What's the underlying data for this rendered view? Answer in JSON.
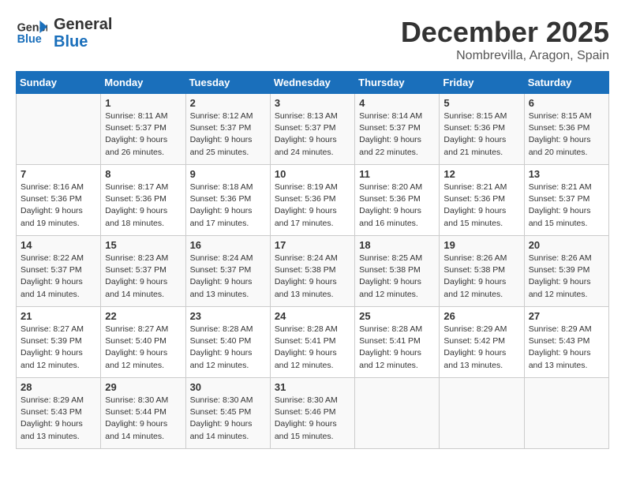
{
  "header": {
    "logo_line1": "General",
    "logo_line2": "Blue",
    "month": "December 2025",
    "location": "Nombrevilla, Aragon, Spain"
  },
  "weekdays": [
    "Sunday",
    "Monday",
    "Tuesday",
    "Wednesday",
    "Thursday",
    "Friday",
    "Saturday"
  ],
  "weeks": [
    [
      {
        "day": "",
        "info": ""
      },
      {
        "day": "1",
        "info": "Sunrise: 8:11 AM\nSunset: 5:37 PM\nDaylight: 9 hours\nand 26 minutes."
      },
      {
        "day": "2",
        "info": "Sunrise: 8:12 AM\nSunset: 5:37 PM\nDaylight: 9 hours\nand 25 minutes."
      },
      {
        "day": "3",
        "info": "Sunrise: 8:13 AM\nSunset: 5:37 PM\nDaylight: 9 hours\nand 24 minutes."
      },
      {
        "day": "4",
        "info": "Sunrise: 8:14 AM\nSunset: 5:37 PM\nDaylight: 9 hours\nand 22 minutes."
      },
      {
        "day": "5",
        "info": "Sunrise: 8:15 AM\nSunset: 5:36 PM\nDaylight: 9 hours\nand 21 minutes."
      },
      {
        "day": "6",
        "info": "Sunrise: 8:15 AM\nSunset: 5:36 PM\nDaylight: 9 hours\nand 20 minutes."
      }
    ],
    [
      {
        "day": "7",
        "info": "Sunrise: 8:16 AM\nSunset: 5:36 PM\nDaylight: 9 hours\nand 19 minutes."
      },
      {
        "day": "8",
        "info": "Sunrise: 8:17 AM\nSunset: 5:36 PM\nDaylight: 9 hours\nand 18 minutes."
      },
      {
        "day": "9",
        "info": "Sunrise: 8:18 AM\nSunset: 5:36 PM\nDaylight: 9 hours\nand 17 minutes."
      },
      {
        "day": "10",
        "info": "Sunrise: 8:19 AM\nSunset: 5:36 PM\nDaylight: 9 hours\nand 17 minutes."
      },
      {
        "day": "11",
        "info": "Sunrise: 8:20 AM\nSunset: 5:36 PM\nDaylight: 9 hours\nand 16 minutes."
      },
      {
        "day": "12",
        "info": "Sunrise: 8:21 AM\nSunset: 5:36 PM\nDaylight: 9 hours\nand 15 minutes."
      },
      {
        "day": "13",
        "info": "Sunrise: 8:21 AM\nSunset: 5:37 PM\nDaylight: 9 hours\nand 15 minutes."
      }
    ],
    [
      {
        "day": "14",
        "info": "Sunrise: 8:22 AM\nSunset: 5:37 PM\nDaylight: 9 hours\nand 14 minutes."
      },
      {
        "day": "15",
        "info": "Sunrise: 8:23 AM\nSunset: 5:37 PM\nDaylight: 9 hours\nand 14 minutes."
      },
      {
        "day": "16",
        "info": "Sunrise: 8:24 AM\nSunset: 5:37 PM\nDaylight: 9 hours\nand 13 minutes."
      },
      {
        "day": "17",
        "info": "Sunrise: 8:24 AM\nSunset: 5:38 PM\nDaylight: 9 hours\nand 13 minutes."
      },
      {
        "day": "18",
        "info": "Sunrise: 8:25 AM\nSunset: 5:38 PM\nDaylight: 9 hours\nand 12 minutes."
      },
      {
        "day": "19",
        "info": "Sunrise: 8:26 AM\nSunset: 5:38 PM\nDaylight: 9 hours\nand 12 minutes."
      },
      {
        "day": "20",
        "info": "Sunrise: 8:26 AM\nSunset: 5:39 PM\nDaylight: 9 hours\nand 12 minutes."
      }
    ],
    [
      {
        "day": "21",
        "info": "Sunrise: 8:27 AM\nSunset: 5:39 PM\nDaylight: 9 hours\nand 12 minutes."
      },
      {
        "day": "22",
        "info": "Sunrise: 8:27 AM\nSunset: 5:40 PM\nDaylight: 9 hours\nand 12 minutes."
      },
      {
        "day": "23",
        "info": "Sunrise: 8:28 AM\nSunset: 5:40 PM\nDaylight: 9 hours\nand 12 minutes."
      },
      {
        "day": "24",
        "info": "Sunrise: 8:28 AM\nSunset: 5:41 PM\nDaylight: 9 hours\nand 12 minutes."
      },
      {
        "day": "25",
        "info": "Sunrise: 8:28 AM\nSunset: 5:41 PM\nDaylight: 9 hours\nand 12 minutes."
      },
      {
        "day": "26",
        "info": "Sunrise: 8:29 AM\nSunset: 5:42 PM\nDaylight: 9 hours\nand 13 minutes."
      },
      {
        "day": "27",
        "info": "Sunrise: 8:29 AM\nSunset: 5:43 PM\nDaylight: 9 hours\nand 13 minutes."
      }
    ],
    [
      {
        "day": "28",
        "info": "Sunrise: 8:29 AM\nSunset: 5:43 PM\nDaylight: 9 hours\nand 13 minutes."
      },
      {
        "day": "29",
        "info": "Sunrise: 8:30 AM\nSunset: 5:44 PM\nDaylight: 9 hours\nand 14 minutes."
      },
      {
        "day": "30",
        "info": "Sunrise: 8:30 AM\nSunset: 5:45 PM\nDaylight: 9 hours\nand 14 minutes."
      },
      {
        "day": "31",
        "info": "Sunrise: 8:30 AM\nSunset: 5:46 PM\nDaylight: 9 hours\nand 15 minutes."
      },
      {
        "day": "",
        "info": ""
      },
      {
        "day": "",
        "info": ""
      },
      {
        "day": "",
        "info": ""
      }
    ]
  ]
}
